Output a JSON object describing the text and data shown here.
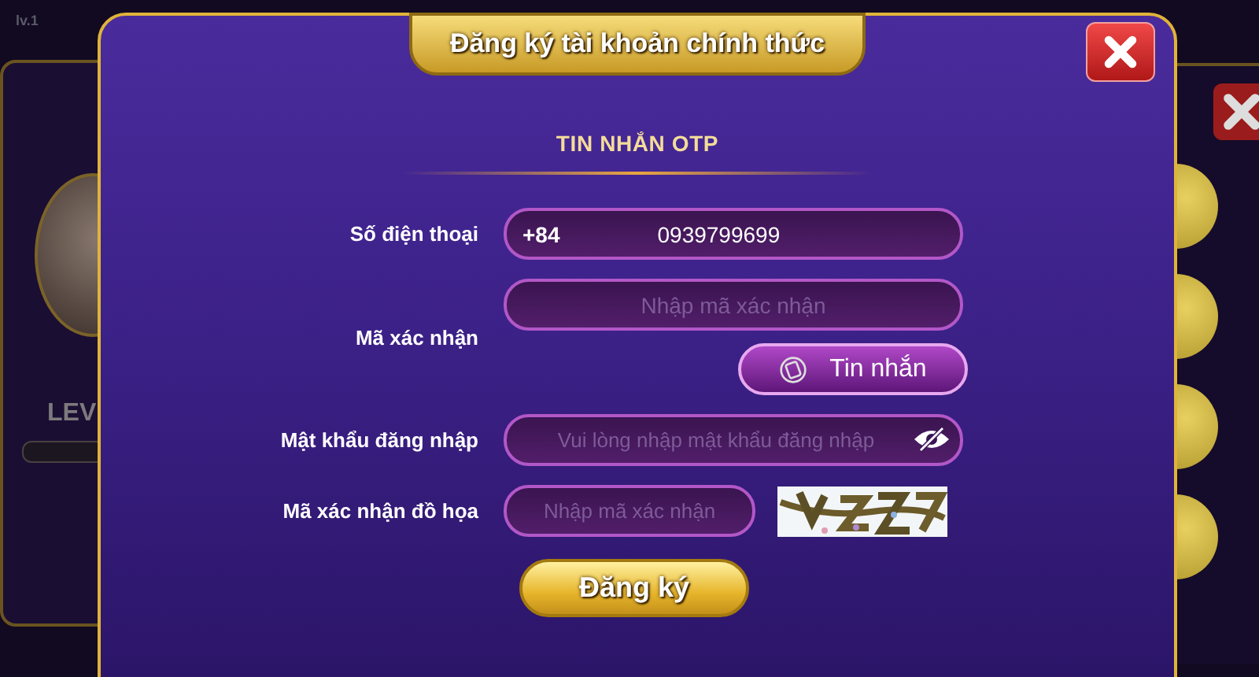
{
  "background": {
    "level_label": "lv.1",
    "level_heading": "LEV"
  },
  "dialog": {
    "title": "Đăng ký tài khoản chính thức",
    "section": "TIN NHẮN OTP",
    "fields": [
      {
        "kind": "phone",
        "label": "Số điện thoại",
        "prefix": "+84",
        "value": "0939799699"
      },
      {
        "kind": "otp",
        "label": "Mã xác nhận",
        "placeholder": "Nhập mã xác nhận",
        "button": "Tin nhắn"
      },
      {
        "kind": "password",
        "label": "Mật khẩu đăng nhập",
        "placeholder": "Vui lòng nhập mật khẩu đăng nhập"
      },
      {
        "kind": "captcha",
        "label": "Mã xác nhận đồ họa",
        "placeholder": "Nhập mã xác nhận"
      }
    ],
    "submit": "Đăng ký"
  }
}
